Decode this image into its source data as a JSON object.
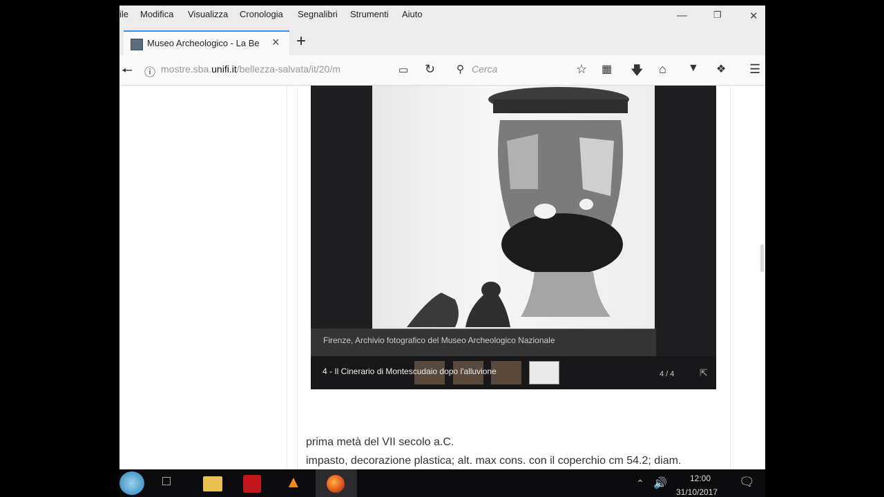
{
  "menu": [
    "ile",
    "Modifica",
    "Visualizza",
    "Cronologia",
    "Segnalibri",
    "Strumenti",
    "Aiuto"
  ],
  "tab": {
    "title": "Museo Archeologico - La Be"
  },
  "nav": {
    "url_prefix": "mostre.sba.",
    "url_domain": "unifi.it",
    "url_path": "/bellezza-salvata/it/20/m",
    "search_placeholder": "Cerca"
  },
  "gallery": {
    "caption": "Firenze, Archivio fotografico del Museo Archeologico Nazionale",
    "slide_title": "4 - Il Cinerario di Montescudaio dopo l'alluvione",
    "counter": "4 / 4"
  },
  "description": {
    "line1": "prima metà del VII secolo a.C.",
    "line2": "impasto, decorazione plastica; alt. max cons. con il coperchio cm 54.2; diam."
  },
  "taskbar": {
    "time": "12:00",
    "date": "31/10/2017"
  },
  "icons": [
    "back-arrow-icon",
    "info-icon",
    "reader-view-icon",
    "reload-icon",
    "search-icon",
    "star-icon",
    "clipboard-icon",
    "download-icon",
    "home-icon",
    "pocket-icon",
    "extension-icon",
    "hamburger-menu-icon"
  ]
}
